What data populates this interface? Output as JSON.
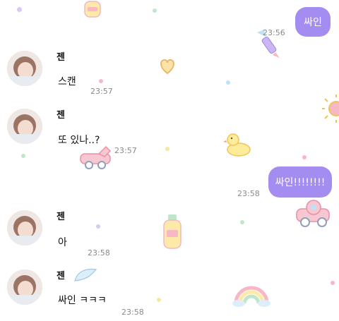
{
  "colors": {
    "outgoing_bubble": "#a58cf0",
    "timestamp": "#8a8a8a"
  },
  "messages": [
    {
      "direction": "out",
      "text": "싸인",
      "time": "23:56"
    },
    {
      "direction": "in",
      "sender": "젠",
      "text": "스캔",
      "time": "23:57"
    },
    {
      "direction": "in",
      "sender": "젠",
      "text": "또 있나..?",
      "time": "23:57"
    },
    {
      "direction": "out",
      "text": "싸인!!!!!!!!",
      "time": "23:58"
    },
    {
      "direction": "in",
      "sender": "젠",
      "text": "아",
      "time": "23:58"
    },
    {
      "direction": "in",
      "sender": "젠",
      "text": "싸인 ㅋㅋㅋ",
      "time": "23:58"
    }
  ],
  "decorations": [
    "bottle-icon",
    "pencil-icon",
    "heart-icon",
    "sun-icon",
    "duck-icon",
    "car-icon",
    "car-icon",
    "bottle-icon",
    "rainbow-icon",
    "wing-icon"
  ]
}
